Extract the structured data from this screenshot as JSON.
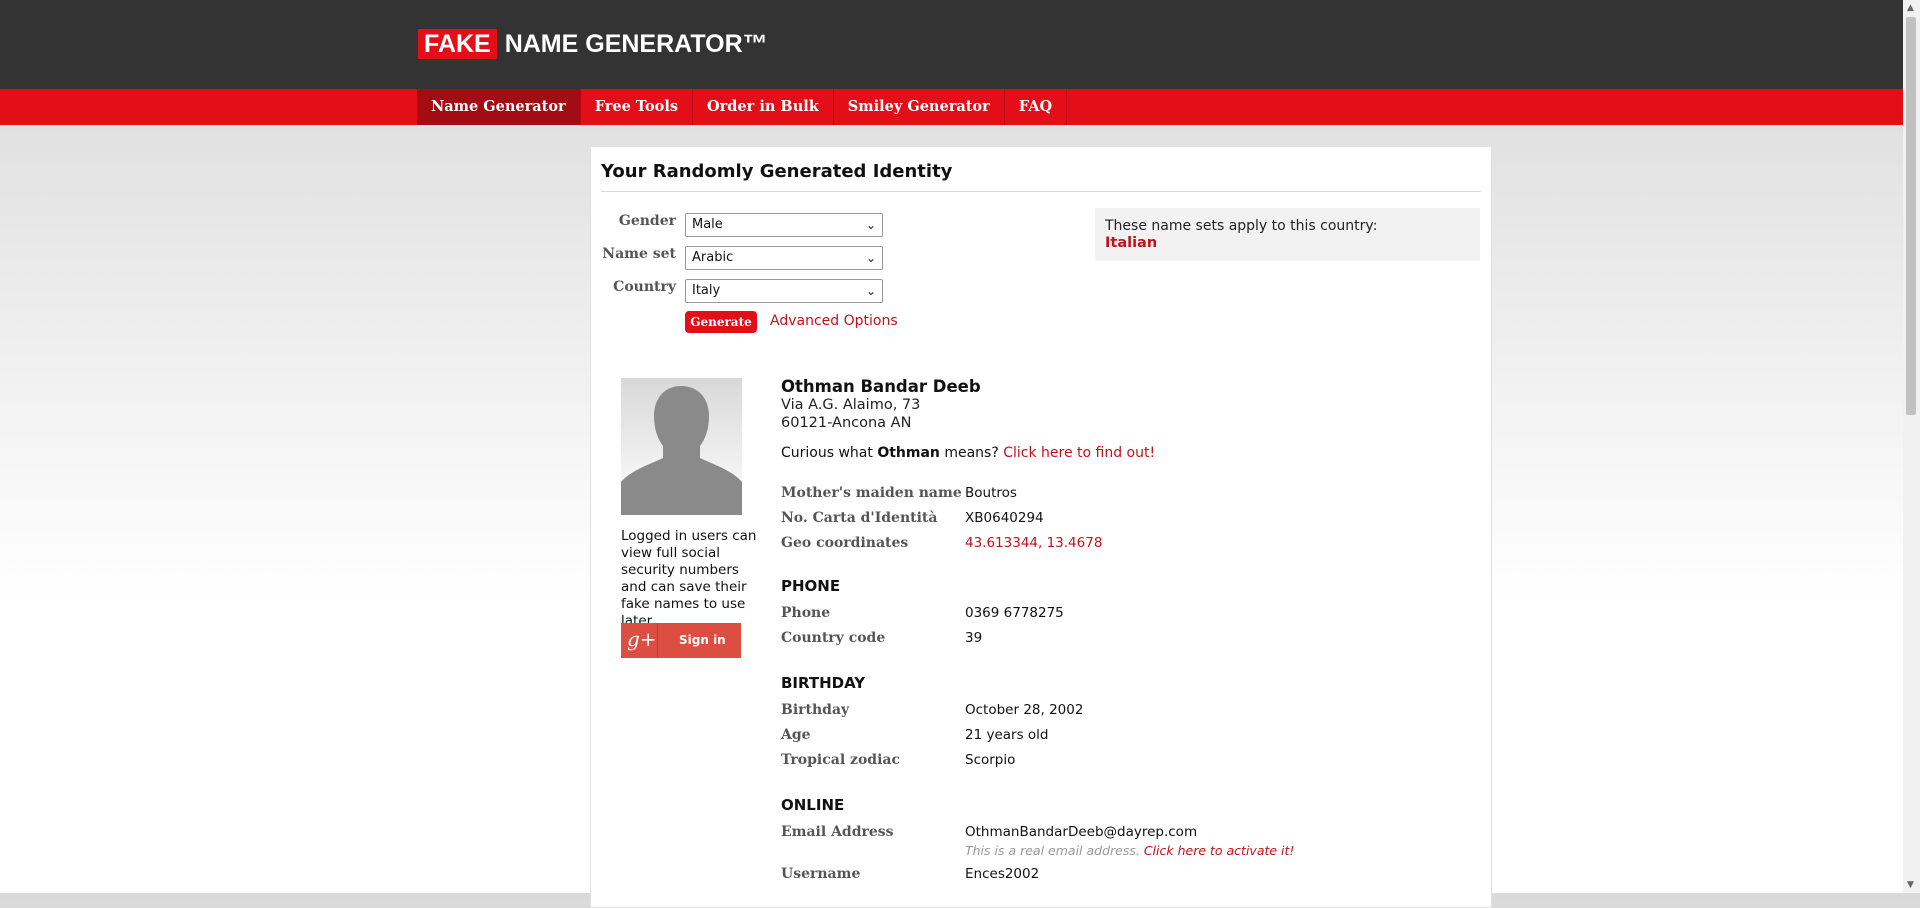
{
  "header": {
    "logo_fake": "FAKE",
    "logo_rest": "NAME GENERATOR™"
  },
  "nav": [
    "Name Generator",
    "Free Tools",
    "Order in Bulk",
    "Smiley Generator",
    "FAQ"
  ],
  "card": {
    "title": "Your Randomly Generated Identity"
  },
  "form": {
    "gender_label": "Gender",
    "gender_value": "Male",
    "nameset_label": "Name set",
    "nameset_value": "Arabic",
    "country_label": "Country",
    "country_value": "Italy",
    "generate": "Generate",
    "advanced": "Advanced Options"
  },
  "country_box": {
    "text": "These name sets apply to this country:",
    "country": "Italian"
  },
  "sidebar": {
    "login_note": "Logged in users can view full social security numbers and can save their fake names to use later.",
    "gplus_glyph": "g+",
    "signin": "Sign in"
  },
  "identity": {
    "name": "Othman Bandar Deeb",
    "address_line1": "Via A.G. Alaimo, 73",
    "address_line2": "60121-Ancona AN",
    "curious_pre": "Curious what ",
    "curious_name": "Othman",
    "curious_post": " means? ",
    "curious_link": "Click here to find out!"
  },
  "fields": {
    "maiden_label": "Mother's maiden name",
    "maiden_value": "Boutros",
    "carta_label": "No. Carta d'Identità",
    "carta_value": "XB0640294",
    "geo_label": "Geo coordinates",
    "geo_value": "43.613344, 13.4678",
    "phone_section": "PHONE",
    "phone_label": "Phone",
    "phone_value": "0369 6778275",
    "cc_label": "Country code",
    "cc_value": "39",
    "birthday_section": "BIRTHDAY",
    "birthday_label": "Birthday",
    "birthday_value": "October 28, 2002",
    "age_label": "Age",
    "age_value": "21 years old",
    "zodiac_label": "Tropical zodiac",
    "zodiac_value": "Scorpio",
    "online_section": "ONLINE",
    "email_label": "Email Address",
    "email_value": "OthmanBandarDeeb@dayrep.com",
    "email_note": "This is a real email address. ",
    "email_note_link": "Click here to activate it!",
    "username_label": "Username",
    "username_value": "Ences2002"
  },
  "colors": {
    "brand_red": "#e30e17",
    "header_bg": "#333333",
    "link_red": "#c4111a"
  }
}
